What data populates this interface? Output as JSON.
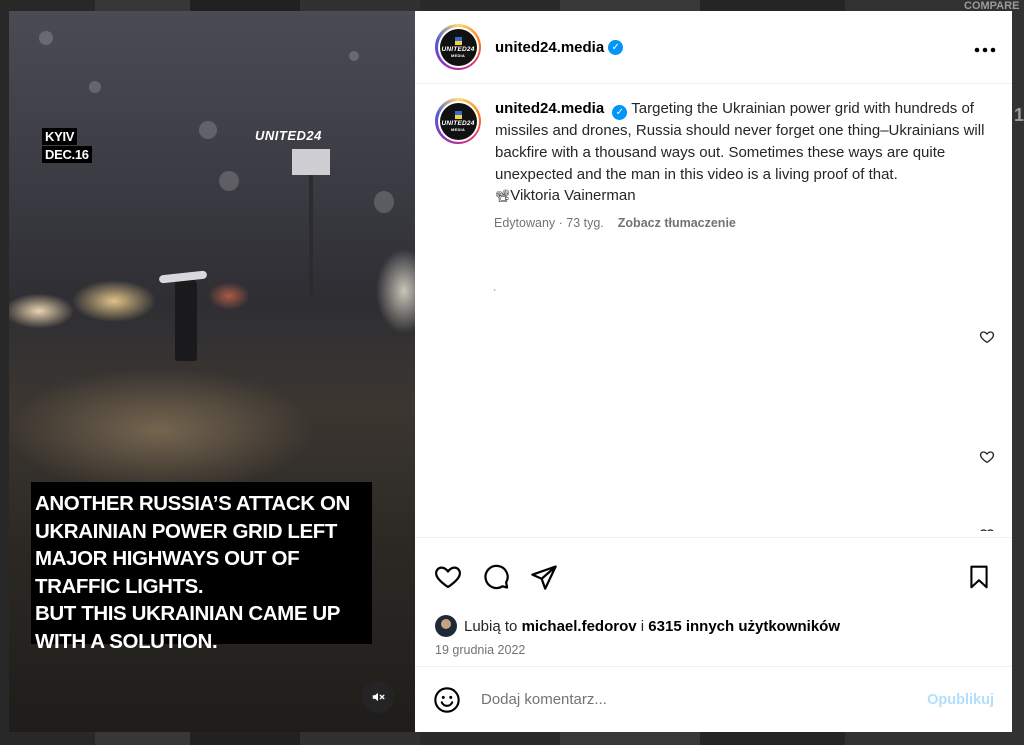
{
  "background": {
    "edge_text_top": "COMPARE",
    "edge_numeral": "1"
  },
  "video": {
    "city_label": "KYIV",
    "date_label": "DEC.16",
    "brand_overlay": "UNITED24",
    "caption_lines": [
      "ANOTHER RUSSIA’S ATTACK ON",
      "UKRAINIAN POWER GRID LEFT",
      "MAJOR HIGHWAYS OUT OF",
      "TRAFFIC LIGHTS.",
      "BUT THIS UKRAINIAN CAME UP",
      "WITH A SOLUTION."
    ],
    "mute_icon": "speaker-muted-icon"
  },
  "header": {
    "avatar_text": "UNITED24",
    "avatar_subtext": "MEDIA",
    "username": "united24.media",
    "more_icon": "more-horizontal-icon"
  },
  "post": {
    "username": "united24.media",
    "caption": "Targeting the Ukrainian power grid with hundreds of missiles and drones, Russia should never forget one thing–Ukrainians will backfire with a thousand ways out. Sometimes these ways are quite unexpected and the man in this video is a living proof of that.",
    "credit_emoji": "📽",
    "credit": "Viktoria Vainerman",
    "edited_meta": "Edytowany · 73 tyg.",
    "translate_label": "Zobacz tłumaczenie",
    "stray_mark": "`"
  },
  "actions": {
    "like_icon": "heart-icon",
    "comment_icon": "comment-icon",
    "share_icon": "share-icon",
    "save_icon": "bookmark-icon"
  },
  "likes": {
    "prefix": "Lubią to",
    "user": "michael.fedorov",
    "joiner": "i",
    "others": "6315 innych użytkowników"
  },
  "post_date": "19 grudnia 2022",
  "comment": {
    "emoji_icon": "emoji-icon",
    "placeholder": "Dodaj komentarz...",
    "publish_label": "Opublikuj"
  },
  "colors": {
    "verified": "#0095f6",
    "publish_disabled": "#b2dffc",
    "secondary_text": "#737373"
  }
}
